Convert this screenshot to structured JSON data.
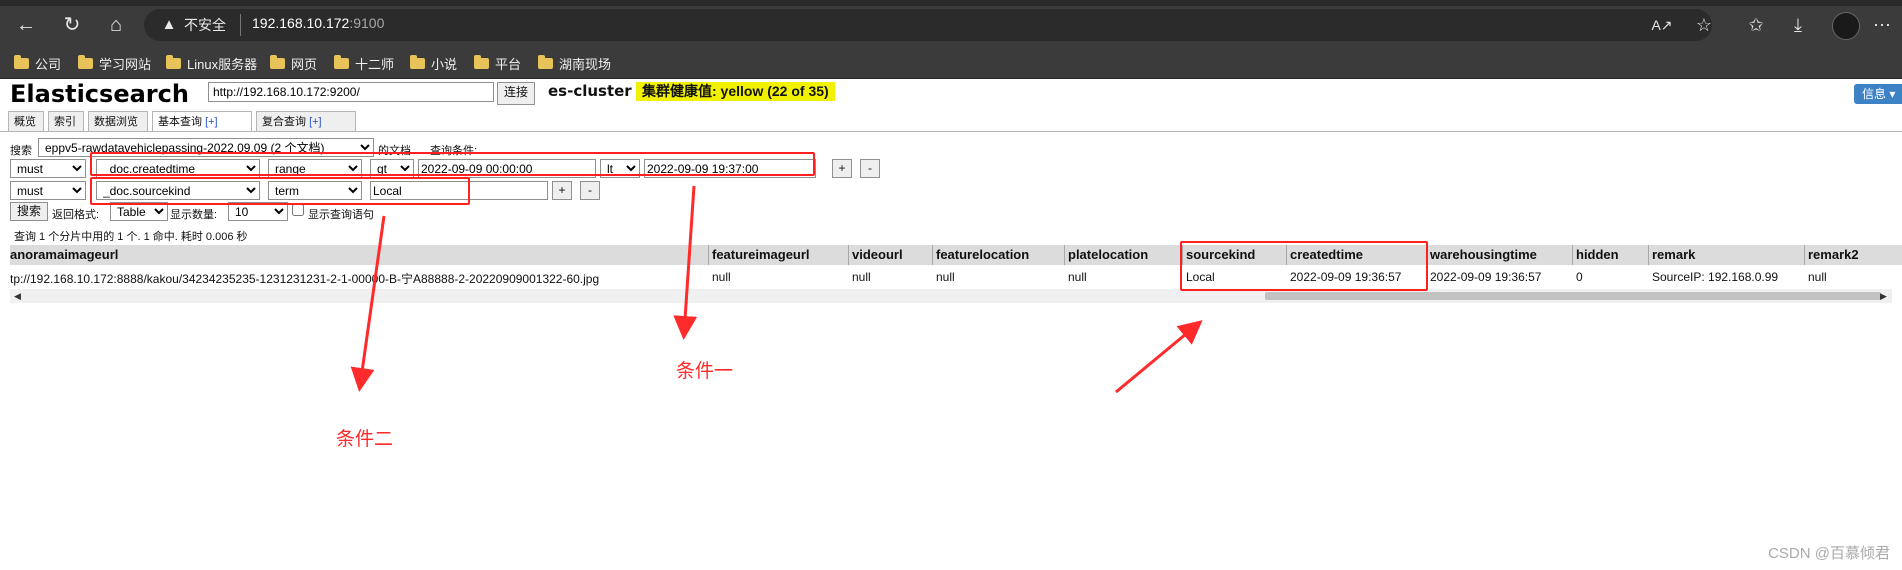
{
  "browser": {
    "insecure_label": "不安全",
    "url_host": "192.168.10.172",
    "url_port": ":9100",
    "bookmarks": [
      "公司",
      "学习网站",
      "Linux服务器",
      "网页",
      "十二师",
      "小说",
      "平台",
      "湖南现场"
    ]
  },
  "app": {
    "title": "Elasticsearch",
    "cluster_url": "http://192.168.10.172:9200/",
    "connect_label": "连接",
    "cluster_name": "es-cluster",
    "health": "集群健康值: yellow (22 of 35)",
    "info_label": "信息 ▾",
    "tabs": [
      {
        "label": "概览",
        "plus": ""
      },
      {
        "label": "索引",
        "plus": ""
      },
      {
        "label": "数据浏览",
        "plus": ""
      },
      {
        "label": "基本查询",
        "plus": "[+]"
      },
      {
        "label": "复合查询",
        "plus": "[+]"
      }
    ]
  },
  "query": {
    "search_label": "搜索",
    "index_value": "eppv5-rawdatavehiclepassing-2022.09.09 (2 个文档)",
    "docs_label": "的文档",
    "condition_label": "查询条件:",
    "row1": {
      "bool": "must",
      "field": "_doc.createdtime",
      "type": "range",
      "op1": "gt",
      "val1": "2022-09-09 00:00:00",
      "op2": "lt",
      "val2": "2022-09-09 19:37:00"
    },
    "row2": {
      "bool": "must",
      "field": "_doc.sourcekind",
      "type": "term",
      "val": "Local"
    },
    "add_label": "+",
    "remove_label": "-",
    "search_btn": "搜索",
    "format_label": "返回格式:",
    "format_value": "Table",
    "count_label": "显示数量:",
    "count_value": "10",
    "show_query_label": "显示查询语句",
    "summary": "查询 1 个分片中用的 1 个. 1 命中. 耗时 0.006 秒"
  },
  "table": {
    "headers": [
      "anoramaimageurl",
      "featureimageurl",
      "videourl",
      "featurelocation",
      "platelocation",
      "sourcekind",
      "createdtime",
      "warehousingtime",
      "hidden",
      "remark",
      "remark2"
    ],
    "row": [
      "tp://192.168.10.172:8888/kakou/34234235235-1231231231-2-1-00000-B-宁A88888-2-20220909001322-60.jpg",
      "null",
      "null",
      "null",
      "null",
      "Local",
      "2022-09-09 19:36:57",
      "2022-09-09 19:36:57",
      "0",
      "SourceIP: 192.168.0.99",
      "null"
    ]
  },
  "annotations": {
    "cond1": "条件一",
    "cond2": "条件二",
    "color": "#ff2a2a"
  },
  "watermark": "CSDN @百慕倾君"
}
